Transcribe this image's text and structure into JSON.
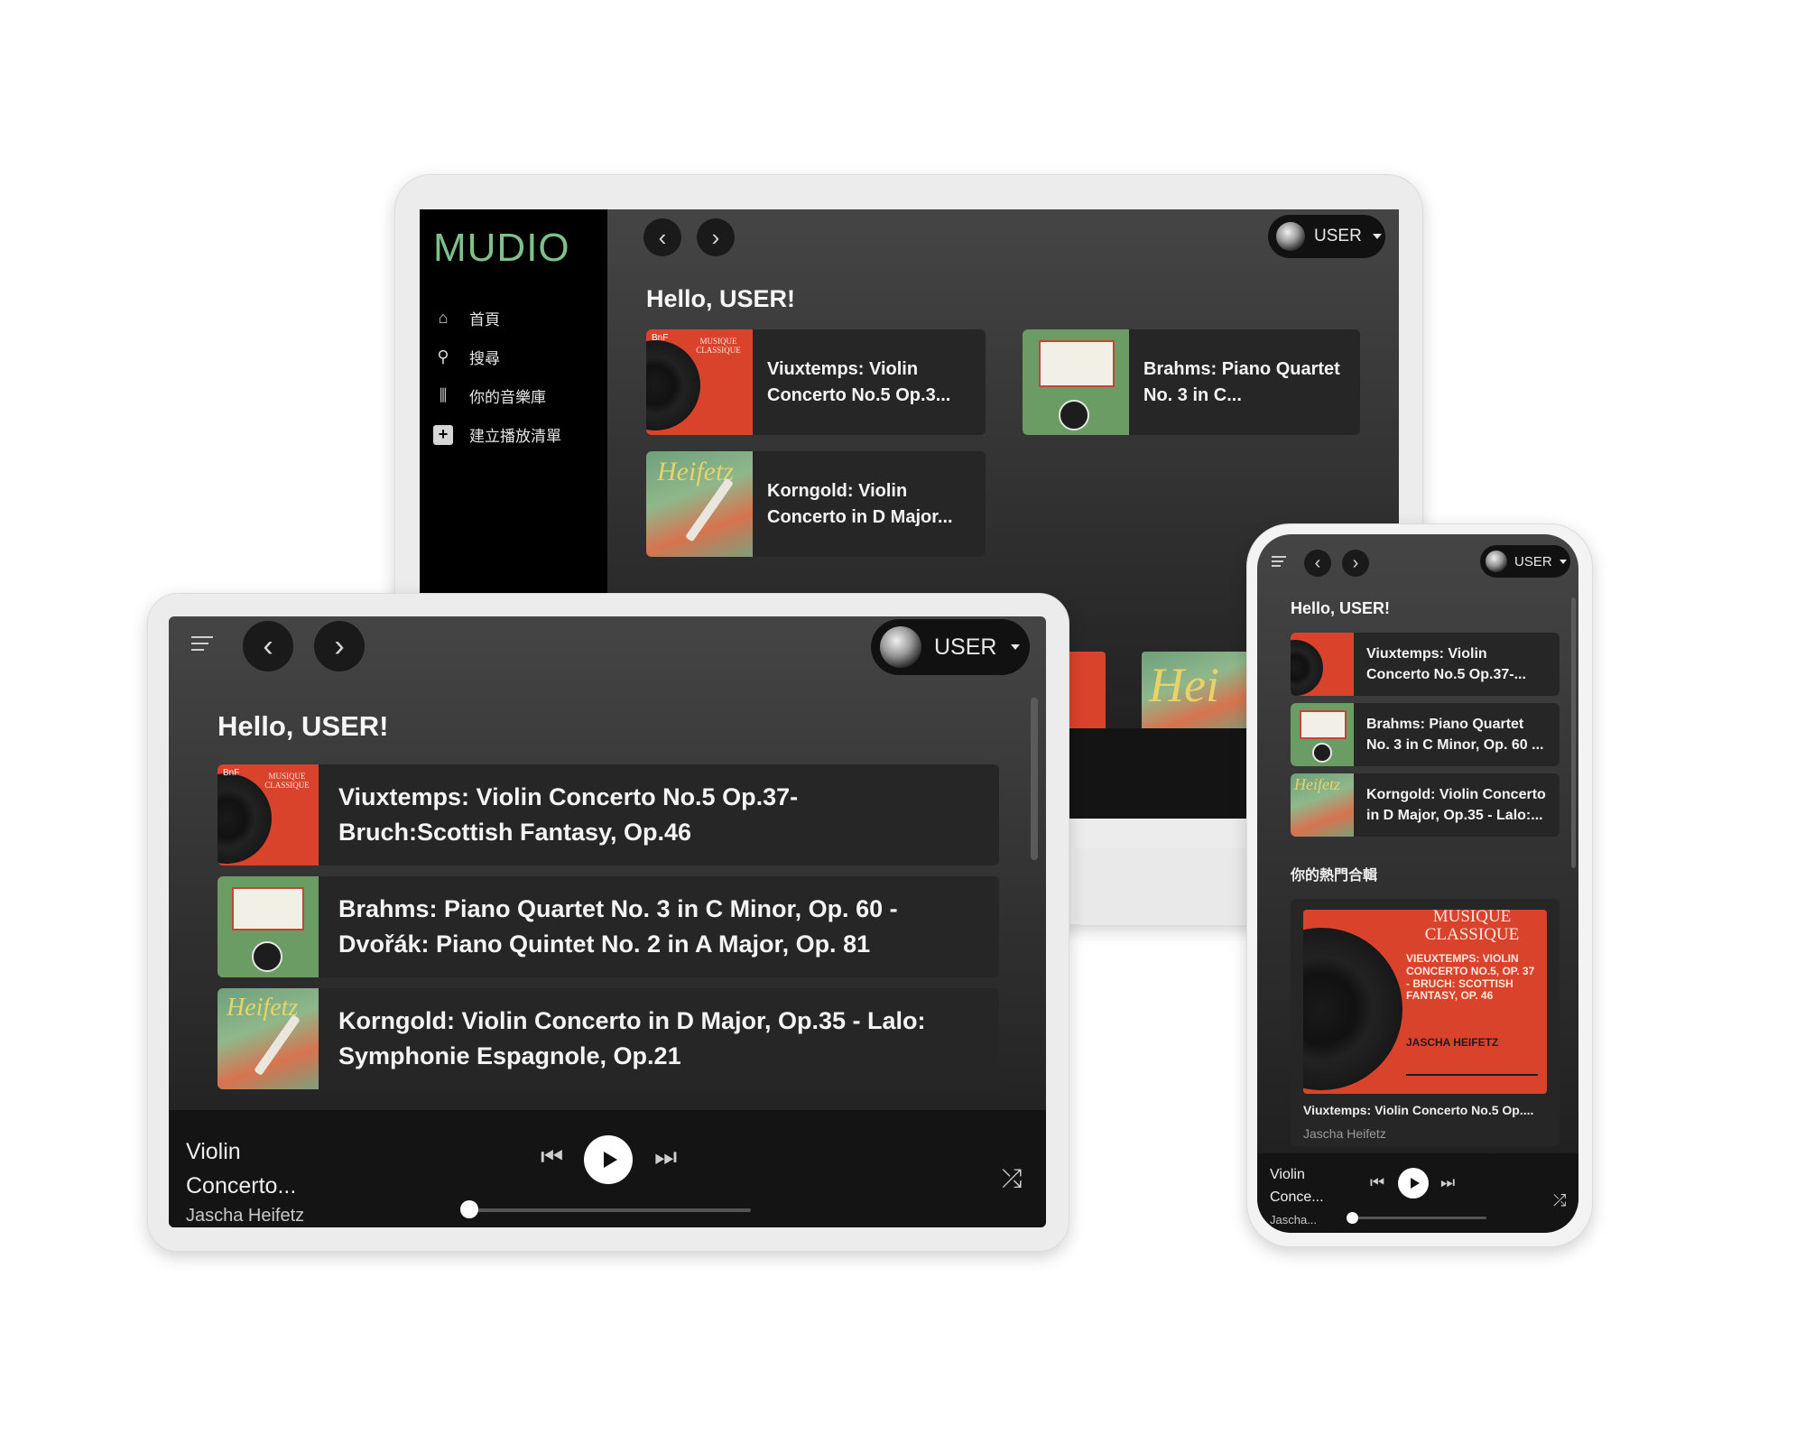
{
  "app": {
    "logo": "MUDIO",
    "logo_color": "#7fbf8a"
  },
  "user": {
    "name": "USER"
  },
  "greeting": "Hello, USER!",
  "sidebar": {
    "items": [
      {
        "icon": "home-icon",
        "label": "首頁"
      },
      {
        "icon": "search-icon",
        "label": "搜尋"
      },
      {
        "icon": "library-icon",
        "label": "你的音樂庫"
      },
      {
        "icon": "add-playlist-icon",
        "label": "建立播放清單"
      }
    ]
  },
  "laptop": {
    "cards": [
      {
        "title": "Viuxtemps: Violin Concerto No.5 Op.3...",
        "cover": "red"
      },
      {
        "title": "Brahms: Piano Quartet No. 3 in C...",
        "cover": "green"
      },
      {
        "title": "Korngold: Violin Concerto in D Major...",
        "cover": "heifetz"
      }
    ]
  },
  "tablet": {
    "cards": [
      {
        "title": "Viuxtemps: Violin Concerto No.5 Op.37-Bruch:Scottish Fantasy, Op.46",
        "cover": "red"
      },
      {
        "title": "Brahms: Piano Quartet No. 3 in C Minor, Op. 60 - Dvořák: Piano Quintet No. 2 in A Major, Op. 81",
        "cover": "green"
      },
      {
        "title": "Korngold: Violin Concerto in D Major, Op.35 - Lalo: Symphonie Espagnole, Op.21",
        "cover": "heifetz"
      }
    ],
    "player": {
      "title": "Violin Concerto...",
      "artist": "Jascha Heifetz",
      "progress": 0.02
    }
  },
  "phone": {
    "cards": [
      {
        "title": "Viuxtemps: Violin Concerto No.5 Op.37-...",
        "cover": "red"
      },
      {
        "title": "Brahms: Piano Quartet No. 3 in C Minor, Op. 60 ...",
        "cover": "green"
      },
      {
        "title": "Korngold: Violin Concerto in D Major, Op.35 - Lalo:...",
        "cover": "heifetz"
      }
    ],
    "section_title": "你的熱門合輯",
    "featured": {
      "cover_heading": "MUSIQUE CLASSIQUE",
      "cover_text": "VIEUXTEMPS: VIOLIN CONCERTO NO.5, OP. 37 - BRUCH: SCOTTISH FANTASY, OP. 46",
      "cover_artist": "JASCHA HEIFETZ",
      "title": "Viuxtemps: Violin Concerto No.5 Op....",
      "artist": "Jascha Heifetz"
    },
    "player": {
      "title": "Violin Conce...",
      "artist": "Jascha...",
      "progress": 0.02
    }
  },
  "covers": {
    "red_heading": "MUSIQUE CLASSIQUE",
    "bnf": "BnF",
    "heifetz_word": "Heifetz"
  }
}
